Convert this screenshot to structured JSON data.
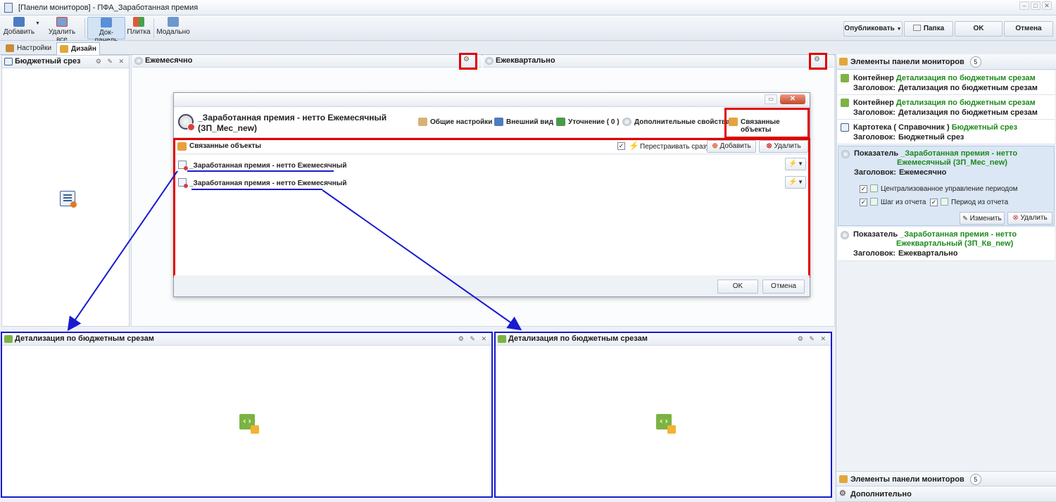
{
  "window": {
    "title": "[Панели мониторов] - ПФА_Заработанная премия"
  },
  "toolbar": {
    "add": "Добавить",
    "delete_all": "Удалить все",
    "dock_panel": "Док-панель",
    "tile": "Плитка",
    "modal": "Модально",
    "publish": "Опубликовать",
    "folder": "Папка",
    "ok": "OK",
    "cancel": "Отмена"
  },
  "tabs": {
    "settings": "Настройки",
    "design": "Дизайн"
  },
  "panels": {
    "budget_slice": "Бюджетный срез",
    "monthly": "Ежемесячно",
    "quarterly": "Ежеквартально",
    "detail_left": "Детализация по бюджетным срезам",
    "detail_right": "Детализация по бюджетным срезам"
  },
  "dialog": {
    "title_line1": "_Заработанная премия - нетто Ежемесячный",
    "title_line2": "(ЗП_Мес_new)",
    "nav": {
      "general": "Общие настройки",
      "appearance": "Внешний вид",
      "refinement": "Уточнение ( 0 )",
      "extra": "Дополнительные свойства",
      "linked": "Связанные объекты"
    },
    "linked_objects": {
      "title": "Связанные объекты",
      "rebuild_now": "Перестраивать сразу",
      "rebuild_checked": "✓",
      "add": "Добавить",
      "delete": "Удалить",
      "rows": [
        "_Заработанная премия - нетто Ежемесячный",
        "_Заработанная премия - нетто Ежемесячный"
      ]
    },
    "ok": "OK",
    "cancel": "Отмена"
  },
  "right_panel": {
    "header": "Элементы панели мониторов",
    "count": "5",
    "items": [
      {
        "type": "Контейнер",
        "name": "Детализация по бюджетным срезам",
        "caption_label": "Заголовок:",
        "caption": "Детализация по бюджетным срезам"
      },
      {
        "type": "Контейнер",
        "name": "Детализация по бюджетным срезам",
        "caption_label": "Заголовок:",
        "caption": "Детализация по бюджетным срезам"
      },
      {
        "type": "Картотека ( Справочник )",
        "name": "Бюджетный срез",
        "caption_label": "Заголовок:",
        "caption": "Бюджетный срез"
      },
      {
        "type": "Показатель",
        "name_line1": "_Заработанная премия - нетто",
        "name_line2": "Ежемесячный (ЗП_Мес_new)",
        "caption_label": "Заголовок:",
        "caption": "Ежемесячно",
        "opt_central": "Централизованное управление периодом",
        "opt_step": "Шаг из отчета",
        "opt_period": "Период из отчета",
        "edit": "Изменить",
        "delete": "Удалить",
        "check": "✓"
      },
      {
        "type": "Показатель",
        "name_line1": "_Заработанная премия - нетто",
        "name_line2": "Ежеквартальный (ЗП_Кв_new)",
        "caption_label": "Заголовок:",
        "caption": "Ежеквартально"
      }
    ],
    "footer_header": "Элементы панели мониторов",
    "footer_count": "5",
    "additional": "Дополнительно"
  },
  "colors": {
    "annotation_red": "#e00000",
    "annotation_blue": "#1a1ad0",
    "green_name": "#1d8a1d"
  }
}
